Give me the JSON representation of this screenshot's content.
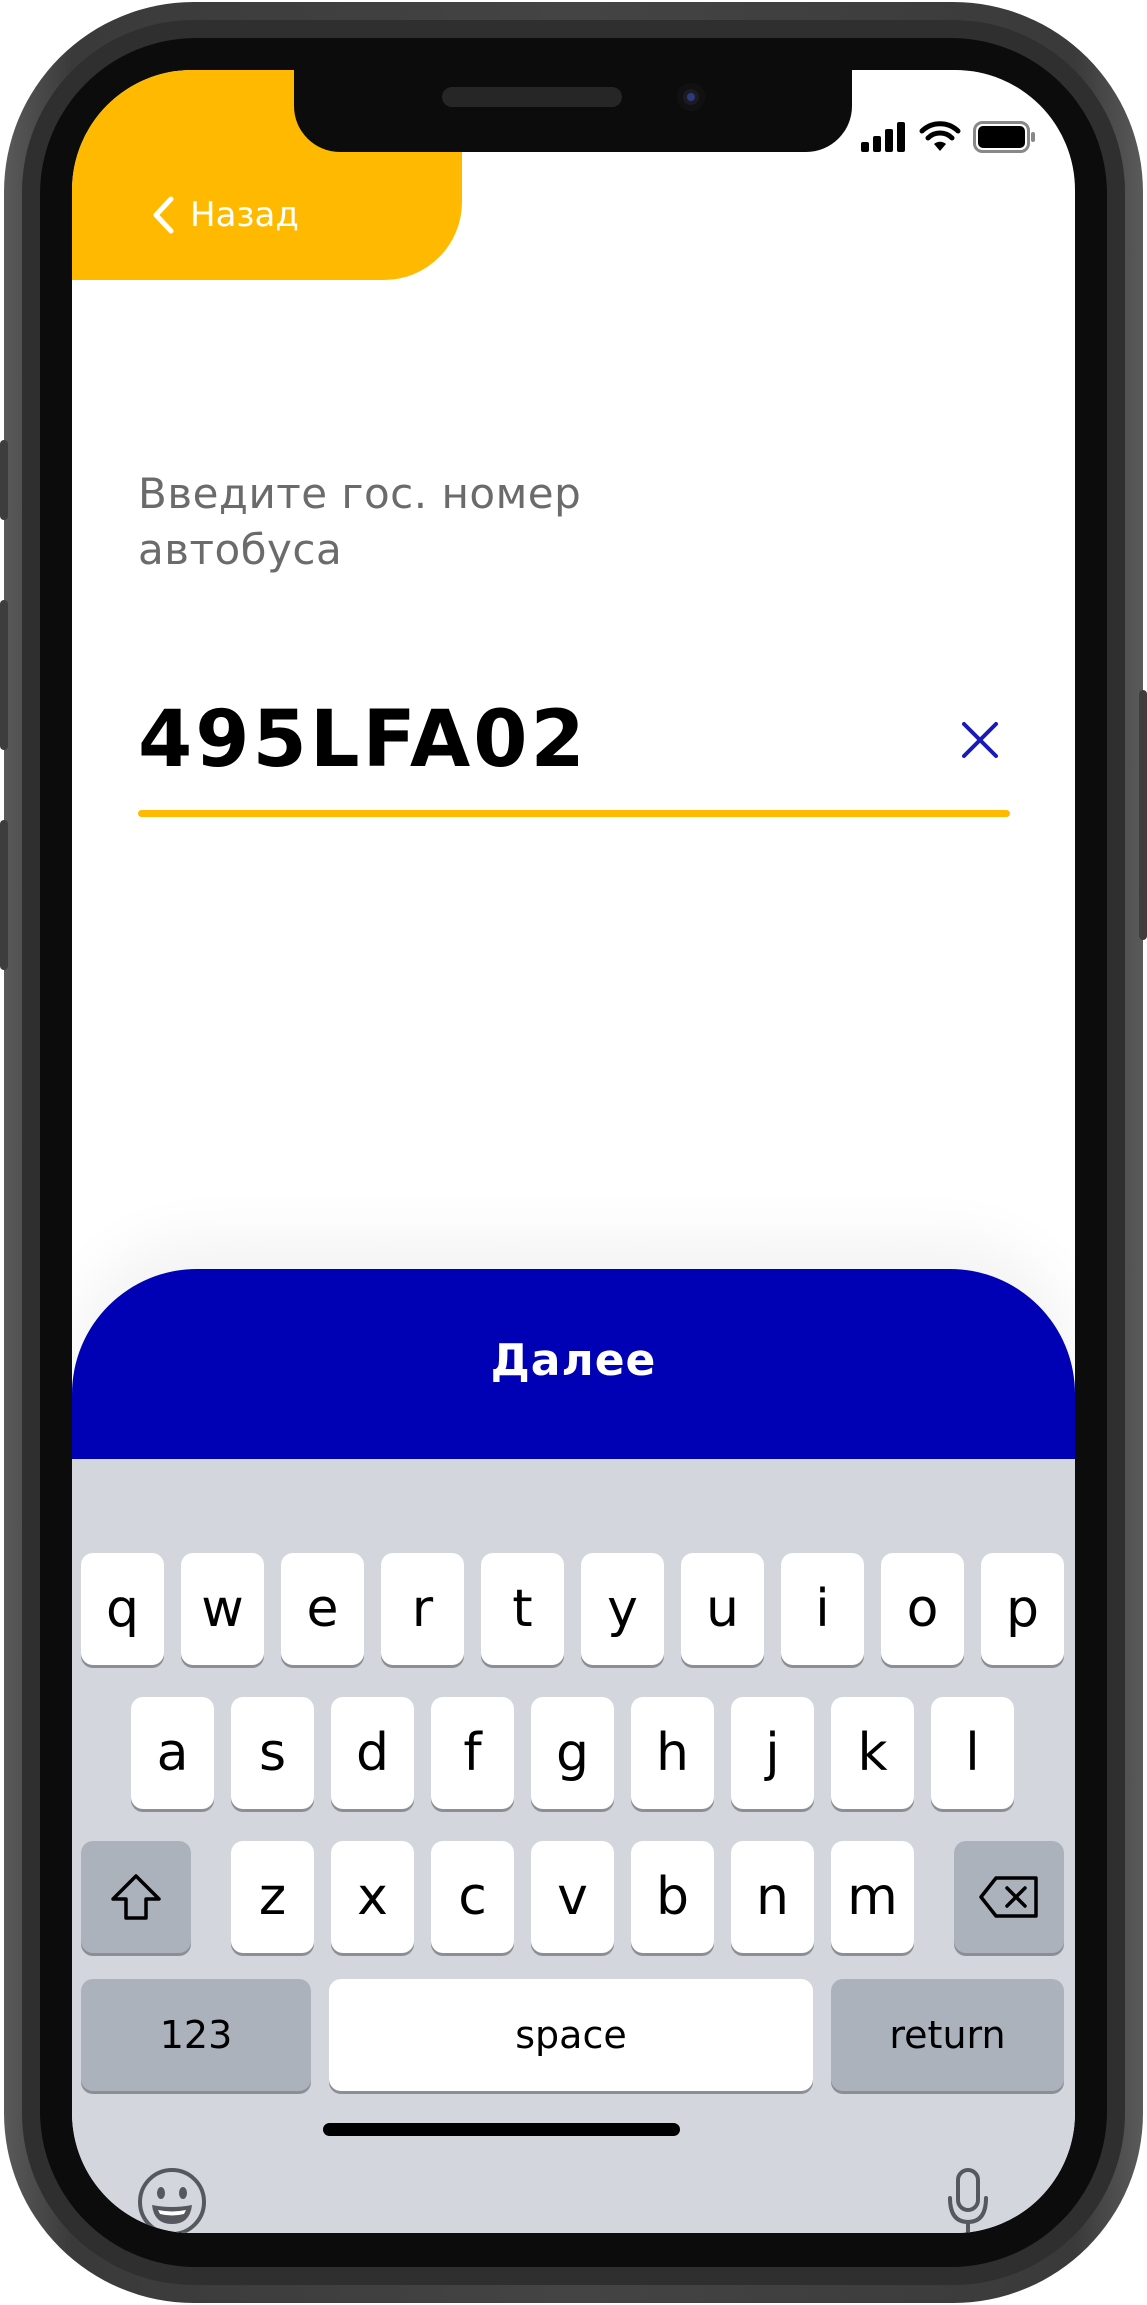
{
  "header": {
    "back_label": "Назад"
  },
  "prompt": {
    "line1": "Введите гос. номер",
    "line2": "автобуса"
  },
  "plate_input": {
    "value": "495LFA02"
  },
  "actions": {
    "next_label": "Далее"
  },
  "keyboard": {
    "row1": [
      "q",
      "w",
      "e",
      "r",
      "t",
      "y",
      "u",
      "i",
      "o",
      "p"
    ],
    "row2": [
      "a",
      "s",
      "d",
      "f",
      "g",
      "h",
      "j",
      "k",
      "l"
    ],
    "row3": [
      "z",
      "x",
      "c",
      "v",
      "b",
      "n",
      "m"
    ],
    "numbers_label": "123",
    "space_label": "space",
    "return_label": "return"
  },
  "colors": {
    "accent_yellow": "#ffba00",
    "primary_blue": "#0000b4",
    "clear_icon_blue": "#1a1ab8"
  },
  "icons": {
    "back": "chevron-left-icon",
    "clear": "close-icon",
    "shift": "shift-icon",
    "delete": "backspace-icon",
    "emoji": "emoji-icon",
    "mic": "microphone-icon",
    "signal": "signal-icon",
    "wifi": "wifi-icon",
    "battery": "battery-icon"
  }
}
